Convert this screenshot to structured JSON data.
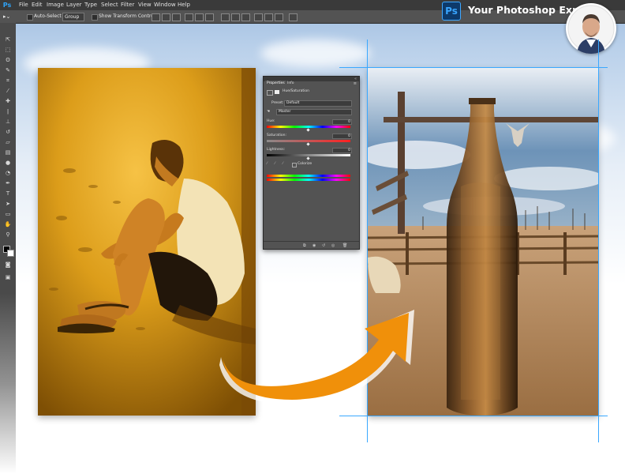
{
  "app": {
    "logo": "Ps"
  },
  "menu": [
    "File",
    "Edit",
    "Image",
    "Layer",
    "Type",
    "Select",
    "Filter",
    "View",
    "Window",
    "Help"
  ],
  "options_bar": {
    "auto_select_label": "Auto-Select",
    "auto_select_value": "Group",
    "transform_controls_label": "Show Transform Controls"
  },
  "brand": {
    "badge": "Ps",
    "name": "Your Photoshop Expert"
  },
  "properties_panel": {
    "tabs": [
      "Properties",
      "Info"
    ],
    "adjustment_title": "Hue/Saturation",
    "preset_label": "Preset:",
    "preset_value": "Default",
    "channel_value": "Master",
    "hue_label": "Hue:",
    "hue_value": "0",
    "saturation_label": "Saturation:",
    "saturation_value": "0",
    "lightness_label": "Lightness:",
    "lightness_value": "0",
    "colorize_label": "Colorize"
  },
  "colors": {
    "menubar": "#3a3a3a",
    "optbar": "#535353",
    "guide": "#3aa8ff",
    "arrow": "#f0900a"
  },
  "icons": [
    "move-icon",
    "marquee-icon",
    "lasso-icon",
    "quick-select-icon",
    "crop-icon",
    "eyedropper-icon",
    "healing-icon",
    "brush-icon",
    "stamp-icon",
    "history-brush-icon",
    "eraser-icon",
    "gradient-icon",
    "blur-icon",
    "dodge-icon",
    "pen-icon",
    "type-icon",
    "path-select-icon",
    "shape-icon",
    "hand-icon",
    "zoom-icon"
  ]
}
